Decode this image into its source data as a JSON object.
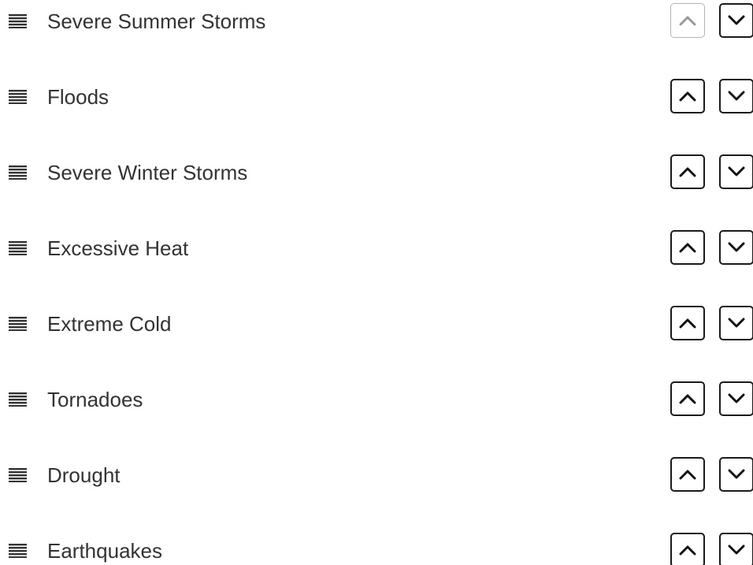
{
  "ranking": {
    "items": [
      {
        "label": "Severe Summer Storms",
        "up_disabled": true,
        "down_disabled": false
      },
      {
        "label": "Floods",
        "up_disabled": false,
        "down_disabled": false
      },
      {
        "label": "Severe Winter Storms",
        "up_disabled": false,
        "down_disabled": false
      },
      {
        "label": "Excessive Heat",
        "up_disabled": false,
        "down_disabled": false
      },
      {
        "label": "Extreme Cold",
        "up_disabled": false,
        "down_disabled": false
      },
      {
        "label": "Tornadoes",
        "up_disabled": false,
        "down_disabled": false
      },
      {
        "label": "Drought",
        "up_disabled": false,
        "down_disabled": false
      },
      {
        "label": "Earthquakes",
        "up_disabled": false,
        "down_disabled": false
      }
    ],
    "icons": {
      "handle": "drag-handle-icon",
      "up": "chevron-up-icon",
      "down": "chevron-down-icon"
    },
    "colors": {
      "text": "#333333",
      "button_border": "#1a1a1a",
      "button_disabled_border": "#b3b3b3",
      "chevron": "#111111",
      "chevron_disabled": "#999999",
      "handle": "#333333"
    }
  }
}
